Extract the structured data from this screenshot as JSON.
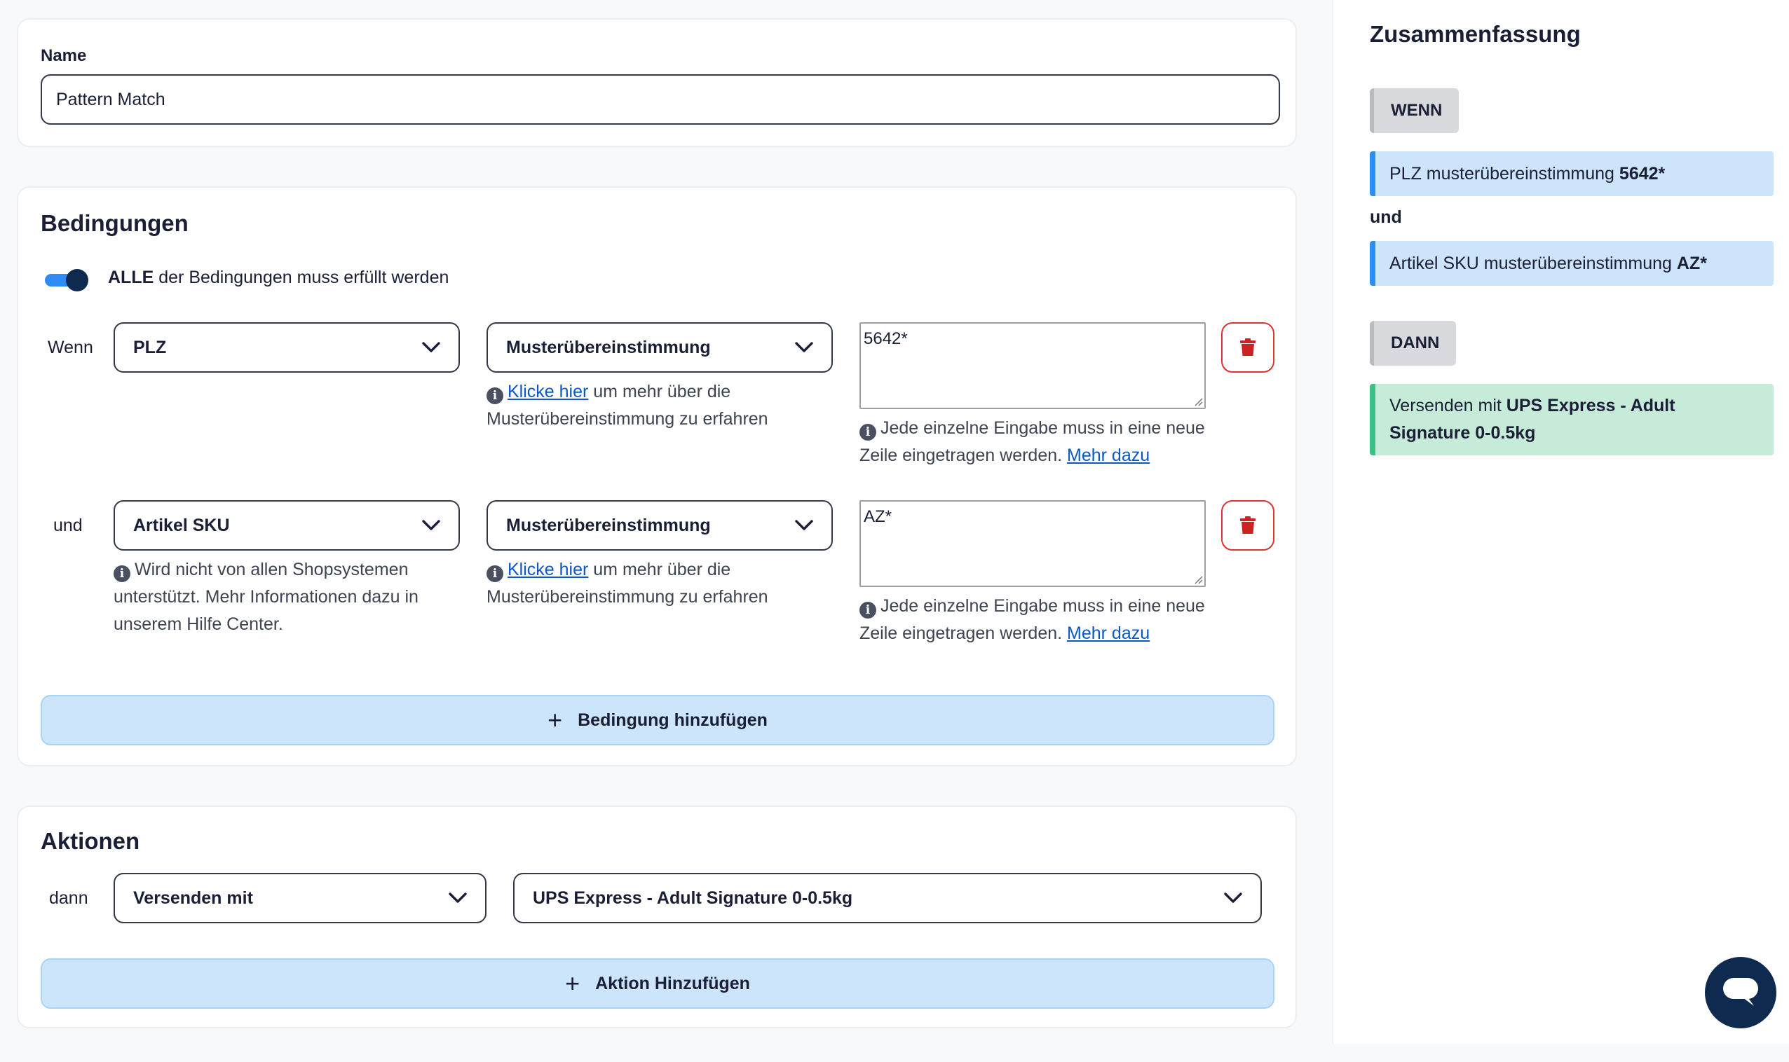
{
  "name_section": {
    "label": "Name",
    "value": "Pattern Match"
  },
  "conditions": {
    "title": "Bedingungen",
    "toggle_bold": "ALLE",
    "toggle_rest": "der Bedingungen muss erfüllt werden",
    "rows": [
      {
        "prefix": "Wenn",
        "field": "PLZ",
        "operator": "Musterübereinstimmung",
        "op_help_link": "Klicke hier",
        "op_help_rest": "um mehr über die Musterübereinstimmung zu erfahren",
        "value": "5642*",
        "value_help": "Jede einzelne Eingabe muss in eine neue Zeile eingetragen werden.",
        "value_help_link": "Mehr dazu"
      },
      {
        "prefix": "und",
        "field": "Artikel SKU",
        "field_help": "Wird nicht von allen Shopsystemen unterstützt. Mehr Informationen dazu in unserem Hilfe Center.",
        "operator": "Musterübereinstimmung",
        "op_help_link": "Klicke hier",
        "op_help_rest": "um mehr über die Musterübereinstimmung zu erfahren",
        "value": "AZ*",
        "value_help": "Jede einzelne Eingabe muss in eine neue Zeile eingetragen werden.",
        "value_help_link": "Mehr dazu"
      }
    ],
    "add_label": "Bedingung hinzufügen"
  },
  "actions": {
    "title": "Aktionen",
    "prefix": "dann",
    "action_type": "Versenden mit",
    "action_value": "UPS Express - Adult Signature 0-0.5kg",
    "add_label": "Aktion Hinzufügen"
  },
  "summary": {
    "title": "Zusammenfassung",
    "if_tag": "WENN",
    "then_tag": "DANN",
    "and_label": "und",
    "cond1_text": "PLZ musterübereinstimmung",
    "cond1_value": "5642*",
    "cond2_text": "Artikel SKU musterübereinstimmung",
    "cond2_value": "AZ*",
    "action_text": "Versenden mit",
    "action_value": "UPS Express - Adult Signature 0-0.5kg"
  },
  "colors": {
    "accent": "#2e8cf5",
    "navy": "#0f2a4f",
    "danger": "#cc2222",
    "add_bg": "#cce5fb",
    "summary_condition_bg": "#cde4fa",
    "summary_action_bg": "#c7ebd9"
  },
  "icons": [
    "chevron-down-icon",
    "info-icon",
    "trash-icon",
    "plus-icon",
    "chat-icon",
    "resize-grip-icon"
  ]
}
